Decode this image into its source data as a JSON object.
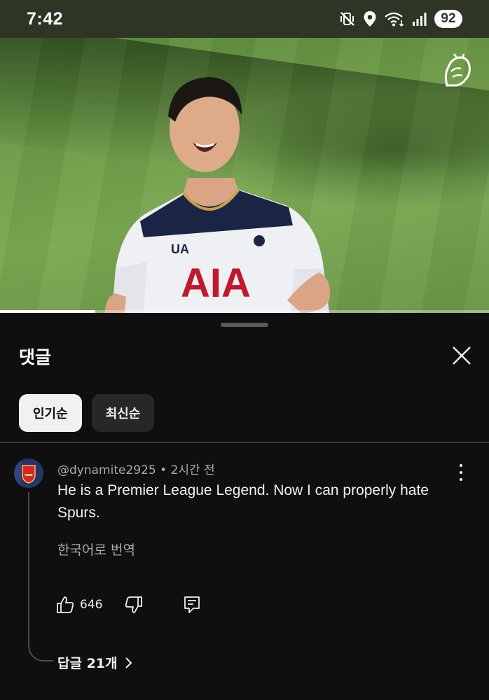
{
  "status_bar": {
    "time": "7:42",
    "battery": "92",
    "icons": [
      "mute-vibrate-icon",
      "location-icon",
      "wifi-icon",
      "signal-icon"
    ]
  },
  "video": {
    "logo_icon": "premier-league-lion-icon",
    "progress": 0.195
  },
  "comments_sheet": {
    "title": "댓글",
    "sort_chips": [
      {
        "label": "인기순",
        "selected": true
      },
      {
        "label": "최신순",
        "selected": false
      }
    ]
  },
  "comment": {
    "author": "@dynamite2925",
    "separator": "•",
    "time": "2시간 전",
    "text": "He is a Premier League Legend. Now I can properly hate Spurs.",
    "translate_label": "한국어로 번역",
    "likes": "646",
    "replies_label": "답글 21개"
  },
  "colors": {
    "background": "#0f0f0f",
    "chip_active": "#f1f1f1",
    "chip_inactive": "#272727",
    "secondary_text": "#aaaaaa"
  }
}
